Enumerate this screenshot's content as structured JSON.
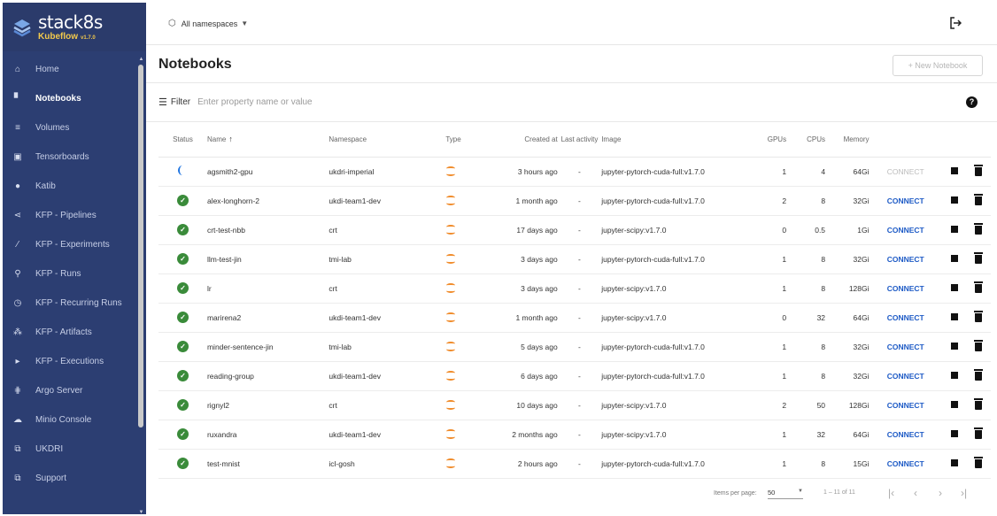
{
  "brand": {
    "name": "stack8s",
    "product": "Kubeflow",
    "version": "v1.7.0"
  },
  "sidebar": {
    "items": [
      {
        "label": "Home",
        "icon": "home-icon",
        "glyph": "⌂",
        "active": false
      },
      {
        "label": "Notebooks",
        "icon": "notebook-icon",
        "glyph": "▘",
        "active": true
      },
      {
        "label": "Volumes",
        "icon": "volumes-icon",
        "glyph": "≡",
        "active": false
      },
      {
        "label": "Tensorboards",
        "icon": "tensorboard-icon",
        "glyph": "▣",
        "active": false
      },
      {
        "label": "Katib",
        "icon": "katib-icon",
        "glyph": "●",
        "active": false
      },
      {
        "label": "KFP - Pipelines",
        "icon": "pipelines-icon",
        "glyph": "⋖",
        "active": false
      },
      {
        "label": "KFP - Experiments",
        "icon": "experiments-icon",
        "glyph": "⁄",
        "active": false
      },
      {
        "label": "KFP - Runs",
        "icon": "runs-icon",
        "glyph": "⚲",
        "active": false
      },
      {
        "label": "KFP - Recurring Runs",
        "icon": "recurring-runs-icon",
        "glyph": "◷",
        "active": false
      },
      {
        "label": "KFP - Artifacts",
        "icon": "artifacts-icon",
        "glyph": "⁂",
        "active": false
      },
      {
        "label": "KFP - Executions",
        "icon": "executions-icon",
        "glyph": "▸",
        "active": false
      },
      {
        "label": "Argo Server",
        "icon": "argo-icon",
        "glyph": "⋕",
        "active": false
      },
      {
        "label": "Minio Console",
        "icon": "cloud-icon",
        "glyph": "☁",
        "active": false
      },
      {
        "label": "UKDRI",
        "icon": "external-link-icon",
        "glyph": "⧉",
        "active": false
      },
      {
        "label": "Support",
        "icon": "external-link-icon",
        "glyph": "⧉",
        "active": false
      }
    ]
  },
  "topbar": {
    "namespace_label": "All namespaces",
    "logout_icon": "logout-icon"
  },
  "page": {
    "title": "Notebooks",
    "new_button": "+ New Notebook"
  },
  "filter": {
    "label": "Filter",
    "placeholder": "Enter property name or value"
  },
  "table": {
    "headers": {
      "status": "Status",
      "name": "Name",
      "namespace": "Namespace",
      "type": "Type",
      "created": "Created at",
      "last_activity": "Last activity",
      "image": "Image",
      "gpus": "GPUs",
      "cpus": "CPUs",
      "memory": "Memory"
    },
    "rows": [
      {
        "status": "starting",
        "name": "agsmith2-gpu",
        "namespace": "ukdri-imperial",
        "created": "3 hours ago",
        "last": "-",
        "image": "jupyter-pytorch-cuda-full:v1.7.0",
        "gpus": "1",
        "cpus": "4",
        "memory": "64Gi",
        "connect": "CONNECT",
        "connect_enabled": false
      },
      {
        "status": "ready",
        "name": "alex-longhorn-2",
        "namespace": "ukdi-team1-dev",
        "created": "1 month ago",
        "last": "-",
        "image": "jupyter-pytorch-cuda-full:v1.7.0",
        "gpus": "2",
        "cpus": "8",
        "memory": "32Gi",
        "connect": "CONNECT",
        "connect_enabled": true
      },
      {
        "status": "ready",
        "name": "crt-test-nbb",
        "namespace": "crt",
        "created": "17 days ago",
        "last": "-",
        "image": "jupyter-scipy:v1.7.0",
        "gpus": "0",
        "cpus": "0.5",
        "memory": "1Gi",
        "connect": "CONNECT",
        "connect_enabled": true
      },
      {
        "status": "ready",
        "name": "llm-test-jin",
        "namespace": "tmi-lab",
        "created": "3 days ago",
        "last": "-",
        "image": "jupyter-pytorch-cuda-full:v1.7.0",
        "gpus": "1",
        "cpus": "8",
        "memory": "32Gi",
        "connect": "CONNECT",
        "connect_enabled": true
      },
      {
        "status": "ready",
        "name": "lr",
        "namespace": "crt",
        "created": "3 days ago",
        "last": "-",
        "image": "jupyter-scipy:v1.7.0",
        "gpus": "1",
        "cpus": "8",
        "memory": "128Gi",
        "connect": "CONNECT",
        "connect_enabled": true
      },
      {
        "status": "ready",
        "name": "marirena2",
        "namespace": "ukdi-team1-dev",
        "created": "1 month ago",
        "last": "-",
        "image": "jupyter-scipy:v1.7.0",
        "gpus": "0",
        "cpus": "32",
        "memory": "64Gi",
        "connect": "CONNECT",
        "connect_enabled": true
      },
      {
        "status": "ready",
        "name": "minder-sentence-jin",
        "namespace": "tmi-lab",
        "created": "5 days ago",
        "last": "-",
        "image": "jupyter-pytorch-cuda-full:v1.7.0",
        "gpus": "1",
        "cpus": "8",
        "memory": "32Gi",
        "connect": "CONNECT",
        "connect_enabled": true
      },
      {
        "status": "ready",
        "name": "reading-group",
        "namespace": "ukdi-team1-dev",
        "created": "6 days ago",
        "last": "-",
        "image": "jupyter-pytorch-cuda-full:v1.7.0",
        "gpus": "1",
        "cpus": "8",
        "memory": "32Gi",
        "connect": "CONNECT",
        "connect_enabled": true
      },
      {
        "status": "ready",
        "name": "rignyl2",
        "namespace": "crt",
        "created": "10 days ago",
        "last": "-",
        "image": "jupyter-scipy:v1.7.0",
        "gpus": "2",
        "cpus": "50",
        "memory": "128Gi",
        "connect": "CONNECT",
        "connect_enabled": true
      },
      {
        "status": "ready",
        "name": "ruxandra",
        "namespace": "ukdi-team1-dev",
        "created": "2 months ago",
        "last": "-",
        "image": "jupyter-scipy:v1.7.0",
        "gpus": "1",
        "cpus": "32",
        "memory": "64Gi",
        "connect": "CONNECT",
        "connect_enabled": true
      },
      {
        "status": "ready",
        "name": "test-mnist",
        "namespace": "icl-gosh",
        "created": "2 hours ago",
        "last": "-",
        "image": "jupyter-pytorch-cuda-full:v1.7.0",
        "gpus": "1",
        "cpus": "8",
        "memory": "15Gi",
        "connect": "CONNECT",
        "connect_enabled": true
      }
    ]
  },
  "paginator": {
    "items_per_page_label": "Items per page:",
    "page_size": "50",
    "range": "1 – 11 of 11"
  },
  "colors": {
    "sidebar_bg": "#2c3e72",
    "accent": "#1e5bc6",
    "ready": "#3a8b3a",
    "brand_sub": "#f2c94c"
  }
}
